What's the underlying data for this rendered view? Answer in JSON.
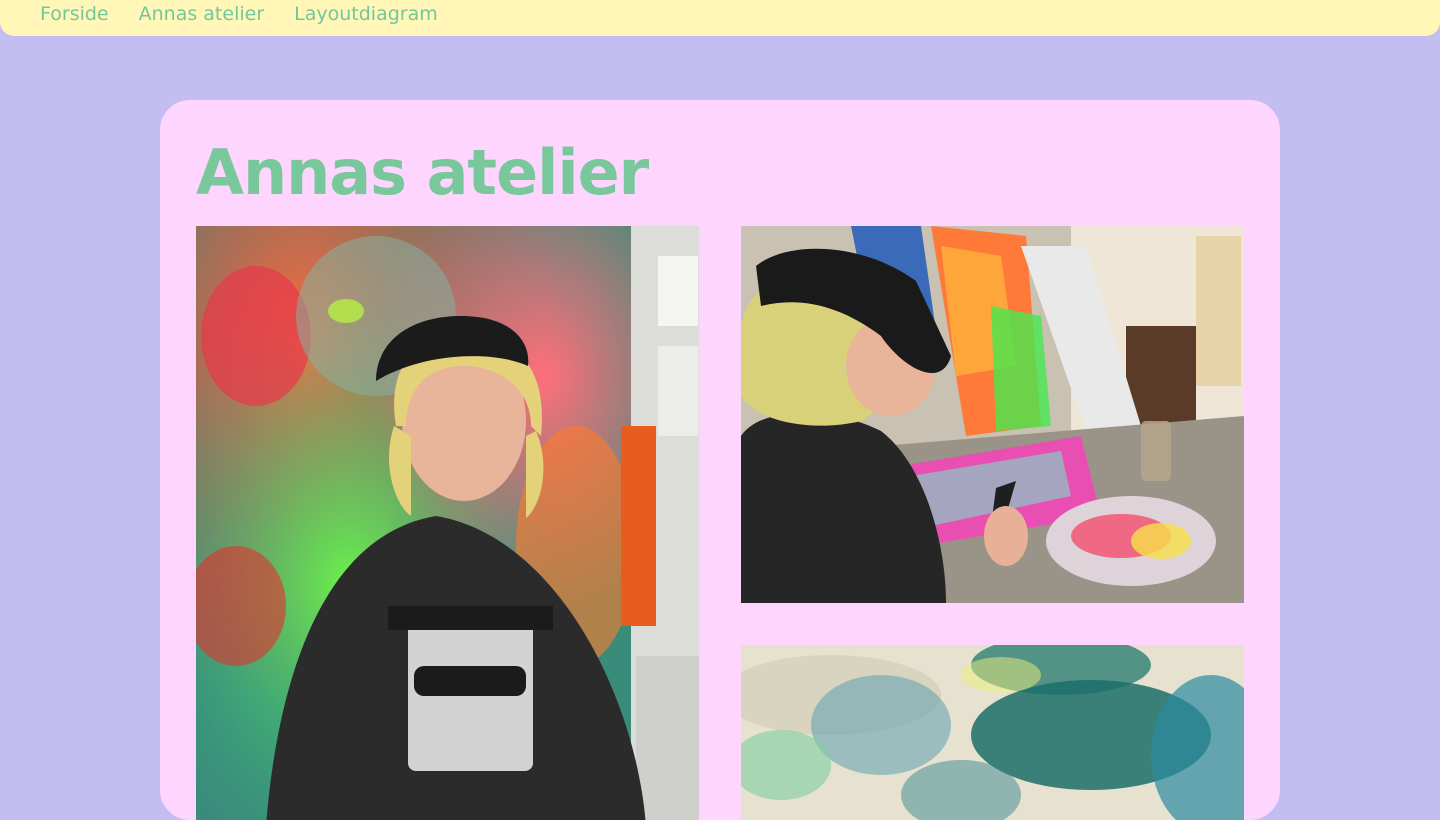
{
  "nav": {
    "items": [
      {
        "label": "Forside"
      },
      {
        "label": "Annas atelier"
      },
      {
        "label": "Layoutdiagram"
      }
    ]
  },
  "page": {
    "title": "Annas atelier"
  },
  "colors": {
    "background": "#c3bdf1",
    "nav_background": "#fff6b8",
    "card_background": "#fdd5ff",
    "accent_green": "#79c89b"
  },
  "gallery": {
    "images": [
      {
        "subject": "portrait"
      },
      {
        "subject": "painting-at-desk"
      },
      {
        "subject": "abstract-painting"
      }
    ]
  }
}
